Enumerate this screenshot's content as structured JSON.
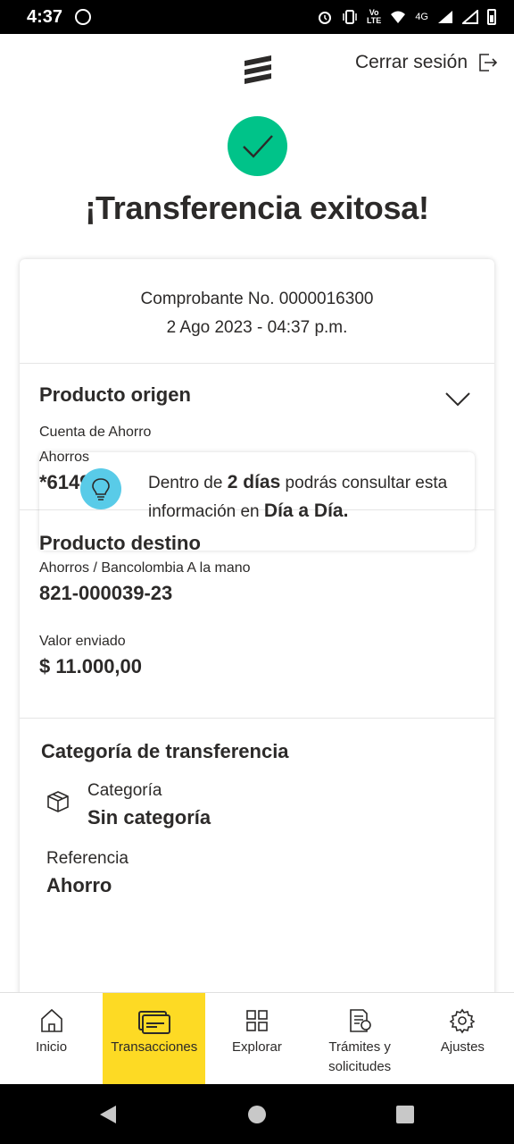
{
  "status_bar": {
    "time": "4:37",
    "volte": "Vo\nLTE",
    "network": "4G"
  },
  "header": {
    "logout_label": "Cerrar sesión"
  },
  "success": {
    "title": "¡Transferencia exitosa!"
  },
  "receipt": {
    "number": "Comprobante No. 0000016300",
    "datetime": "2 Ago 2023 - 04:37 p.m."
  },
  "origin": {
    "title": "Producto origen",
    "account_type": "Cuenta de Ahorro",
    "subtype": "Ahorros",
    "number": "*6149"
  },
  "destination": {
    "title": "Producto destino",
    "account": "Ahorros / Bancolombia A la mano",
    "number": "821-000039-23",
    "amount_label": "Valor enviado",
    "amount": "$ 11.000,00"
  },
  "category_section": {
    "title": "Categoría de transferencia",
    "category_label": "Categoría",
    "category_value": "Sin categoría",
    "reference_label": "Referencia",
    "reference_value": "Ahorro"
  },
  "tip": {
    "part1": "Dentro de ",
    "bold1": "2 días",
    "part2": " podrás consultar esta información en ",
    "bold2": "Día a Día."
  },
  "bottom_nav": {
    "items": [
      {
        "label": "Inicio",
        "icon": "home-icon"
      },
      {
        "label": "Transacciones",
        "icon": "transactions-icon",
        "active": true
      },
      {
        "label": "Explorar",
        "icon": "grid-icon"
      },
      {
        "label": "Trámites y solicitudes",
        "icon": "documents-icon"
      },
      {
        "label": "Ajustes",
        "icon": "gear-icon"
      }
    ]
  },
  "colors": {
    "accent_yellow": "#fdda24",
    "success_green": "#00c389",
    "info_blue": "#59cbe8"
  }
}
